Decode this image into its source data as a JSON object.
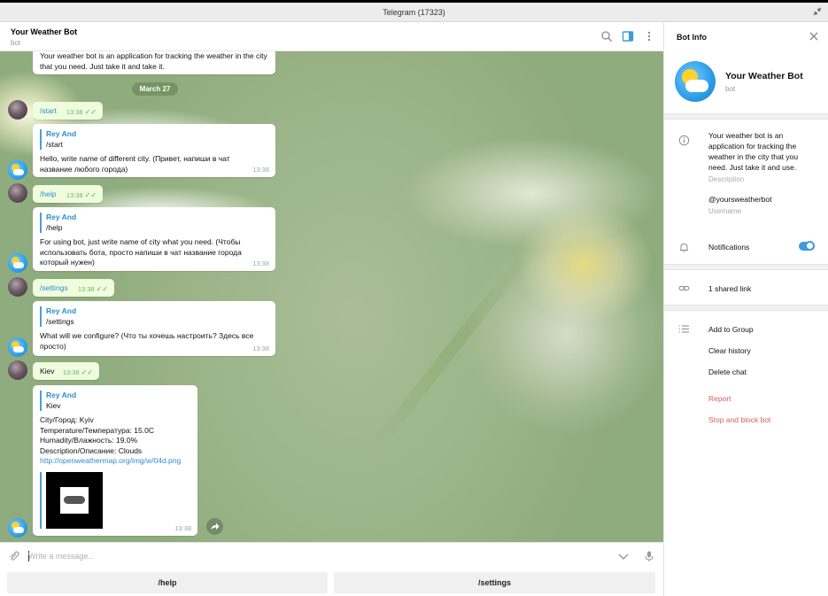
{
  "window": {
    "title": "Telegram (17323)"
  },
  "chat": {
    "name": "Your Weather Bot",
    "status": "bot",
    "date": "March 27",
    "top_message": "Your weather bot is an application for tracking the weather in the city that you need. Just take it and take it.",
    "messages": [
      {
        "text": "/start",
        "time": "13:38"
      },
      {
        "reply_name": "Rey And",
        "reply_text": "/start",
        "text": "Hello, write name of different city. (Привет, напиши в чат название любого города)",
        "time": "13:38"
      },
      {
        "text": "/help",
        "time": "13:38"
      },
      {
        "reply_name": "Rey And",
        "reply_text": "/help",
        "text": "For using bot, just write name of city what you need. (Чтобы использовать бота, просто напиши в чат название города который нужен)",
        "time": "13:38"
      },
      {
        "text": "/settings",
        "time": "13:38"
      },
      {
        "reply_name": "Rey And",
        "reply_text": "/settings",
        "text": "What will we configure? (Что ты хочешь настроить? Здесь все просто)",
        "time": "13:38"
      },
      {
        "text": "Kiev",
        "time": "13:38"
      },
      {
        "reply_name": "Rey And",
        "reply_text": "Kiev",
        "line1": "City/Город: Kyiv",
        "line2": "Temperature/Температура: 15.0C",
        "line3": "Humadity/Влажность: 19.0%",
        "line4": "Description/Описание: Clouds",
        "link": "http://openweathermap.org/img/w/04d.png",
        "time": "13:38"
      }
    ]
  },
  "composer": {
    "placeholder": "Write a message..."
  },
  "keyboard": {
    "buttons": [
      "/help",
      "/settings"
    ]
  },
  "info": {
    "title": "Bot Info",
    "name": "Your Weather Bot",
    "sub": "bot",
    "description": "Your weather bot is an application for tracking the weather in the city that you need. Just take it and use.",
    "description_label": "Description",
    "username": "@yoursweatherbot",
    "username_label": "Username",
    "notifications": "Notifications",
    "notifications_on": true,
    "shared": "1 shared link",
    "actions": [
      "Add to Group",
      "Clear history",
      "Delete chat"
    ],
    "danger_actions": [
      "Report",
      "Stop and block bot"
    ]
  },
  "colors": {
    "accent": "#3d9be0",
    "link": "#2d8ccf",
    "danger": "#d55e5e",
    "outgoing": "#effdde"
  },
  "icons": [
    "search-icon",
    "sidebar-toggle-icon",
    "more-icon",
    "close-icon",
    "attach-icon",
    "emoji-chevron-icon",
    "microphone-icon",
    "forward-icon",
    "info-icon",
    "bell-icon",
    "link-icon",
    "list-icon",
    "minimize-icon"
  ]
}
